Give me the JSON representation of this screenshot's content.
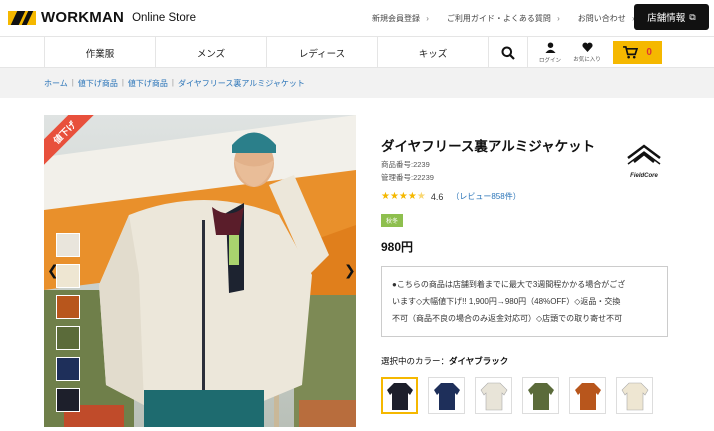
{
  "header": {
    "logo_text": "WORKMAN",
    "logo_sub": "Online Store",
    "links": [
      "新規会員登録",
      "ご利用ガイド・よくある質問",
      "お問い合わせ"
    ],
    "store_info_label": "店舗情報"
  },
  "nav": {
    "items": [
      "作業服",
      "メンズ",
      "レディース",
      "キッズ"
    ],
    "login_label": "ログイン",
    "favorites_label": "お気に入り",
    "cart_count": "0"
  },
  "breadcrumb": [
    "ホーム",
    "値下げ商品",
    "値下げ商品",
    "ダイヤフリース裏アルミジャケット"
  ],
  "product": {
    "sale_ribbon": "値下げ",
    "title": "ダイヤフリース裏アルミジャケット",
    "product_no": "商品番号:2239",
    "control_no": "管理番号:22239",
    "brand": "FieldCore",
    "rating": "4.6",
    "rating_value": 4.6,
    "review_label": "（レビュー858件）",
    "badge": "秋冬",
    "price": "980円",
    "notice_lines": [
      "●こちらの商品は店舗到着までに最大で3週間程かかる場合がござ",
      "います◇大幅値下げ!! 1,900円→980円（48%OFF）◇返品・交換",
      "不可（商品不良の場合のみ返金対応可）◇店頭での取り寄せ不可"
    ],
    "color_label_prefix": "選択中のカラー：",
    "selected_color": "ダイヤブラック"
  },
  "colors": {
    "accent": "#f5b800",
    "link": "#2a74b8",
    "swatches": [
      "#1d1f2b",
      "#1e2f5a",
      "#e8e4d8",
      "#5b6b3a",
      "#b8561c",
      "#eee6d2"
    ],
    "thumbs": [
      "#e9e5dc",
      "#eee6d2",
      "#b8561c",
      "#5b6b3a",
      "#1e2f5a",
      "#1d1f2b"
    ]
  }
}
